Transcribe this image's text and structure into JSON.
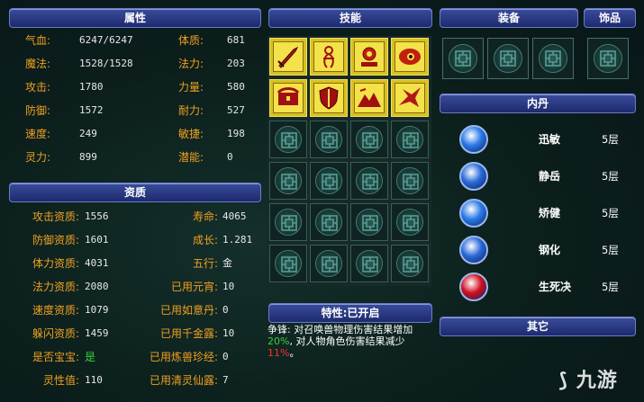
{
  "headers": {
    "attributes": "属性",
    "aptitude": "资质",
    "skills": "技能",
    "equipment": "装备",
    "ornament": "饰品",
    "inner_dan": "内丹",
    "trait": "特性:已开启",
    "other": "其它"
  },
  "attributes": [
    {
      "label": "气血:",
      "value": "6247/6247"
    },
    {
      "label": "魔法:",
      "value": "1528/1528"
    },
    {
      "label": "攻击:",
      "value": "1780"
    },
    {
      "label": "防御:",
      "value": "1572"
    },
    {
      "label": "速度:",
      "value": "249"
    },
    {
      "label": "灵力:",
      "value": "899"
    }
  ],
  "attributes_right": [
    {
      "label": "体质:",
      "value": "681"
    },
    {
      "label": "法力:",
      "value": "203"
    },
    {
      "label": "力量:",
      "value": "580"
    },
    {
      "label": "耐力:",
      "value": "527"
    },
    {
      "label": "敏捷:",
      "value": "198"
    },
    {
      "label": "潜能:",
      "value": "0"
    }
  ],
  "aptitude_left": [
    {
      "label": "攻击资质:",
      "value": "1556"
    },
    {
      "label": "防御资质:",
      "value": "1601"
    },
    {
      "label": "体力资质:",
      "value": "4031"
    },
    {
      "label": "法力资质:",
      "value": "2080"
    },
    {
      "label": "速度资质:",
      "value": "1079"
    },
    {
      "label": "躲闪资质:",
      "value": "1459"
    },
    {
      "label": "是否宝宝:",
      "value": "是"
    },
    {
      "label": "灵性值:",
      "value": "110"
    }
  ],
  "aptitude_right": [
    {
      "label": "寿命:",
      "value": "4065"
    },
    {
      "label": "成长:",
      "value": "1.281"
    },
    {
      "label": "五行:",
      "value": "金"
    },
    {
      "label": "已用元宵:",
      "value": "10"
    },
    {
      "label": "已用如意丹:",
      "value": "0"
    },
    {
      "label": "已用千金露:",
      "value": "10"
    },
    {
      "label": "已用炼兽珍经:",
      "value": "0"
    },
    {
      "label": "已用清灵仙露:",
      "value": "7"
    }
  ],
  "skills": [
    {
      "icon": "sword-skill-icon"
    },
    {
      "icon": "figure-skill-icon"
    },
    {
      "icon": "altar-skill-icon"
    },
    {
      "icon": "eye-skill-icon"
    },
    {
      "icon": "chest-skill-icon"
    },
    {
      "icon": "shield-skill-icon"
    },
    {
      "icon": "mountain-skill-icon"
    },
    {
      "icon": "bird-skill-icon"
    }
  ],
  "inner_dan": [
    {
      "name": "迅敏",
      "level": "5层",
      "color": "#2a7ae8"
    },
    {
      "name": "静岳",
      "level": "5层",
      "color": "#2a6ad8"
    },
    {
      "name": "矫健",
      "level": "5层",
      "color": "#2a7ae8"
    },
    {
      "name": "钢化",
      "level": "5层",
      "color": "#2a6ad8"
    },
    {
      "name": "生死决",
      "level": "5层",
      "color": "#d01020"
    }
  ],
  "trait": {
    "line1": "争锋: 对召唤兽物理伤害结果增加",
    "pct1": "20%",
    "line2": ", 对人物角色伤害结果减少",
    "pct2": "11%",
    "line3": "。"
  },
  "watermark": "九游"
}
